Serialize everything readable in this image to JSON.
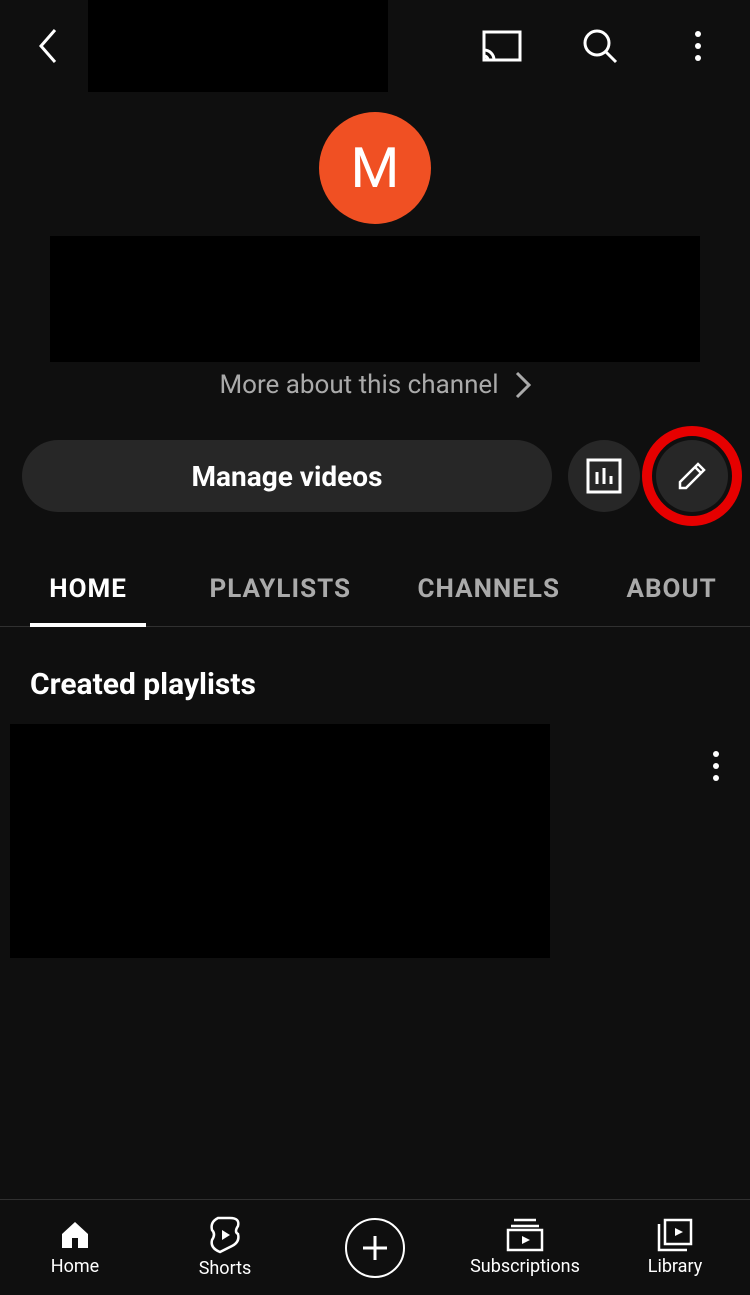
{
  "avatar_letter": "M",
  "more_label": "More about this channel",
  "manage_label": "Manage videos",
  "tabs": {
    "home": "HOME",
    "playlists": "PLAYLISTS",
    "channels": "CHANNELS",
    "about": "ABOUT"
  },
  "section_created": "Created playlists",
  "nav": {
    "home": "Home",
    "shorts": "Shorts",
    "subscriptions": "Subscriptions",
    "library": "Library"
  }
}
